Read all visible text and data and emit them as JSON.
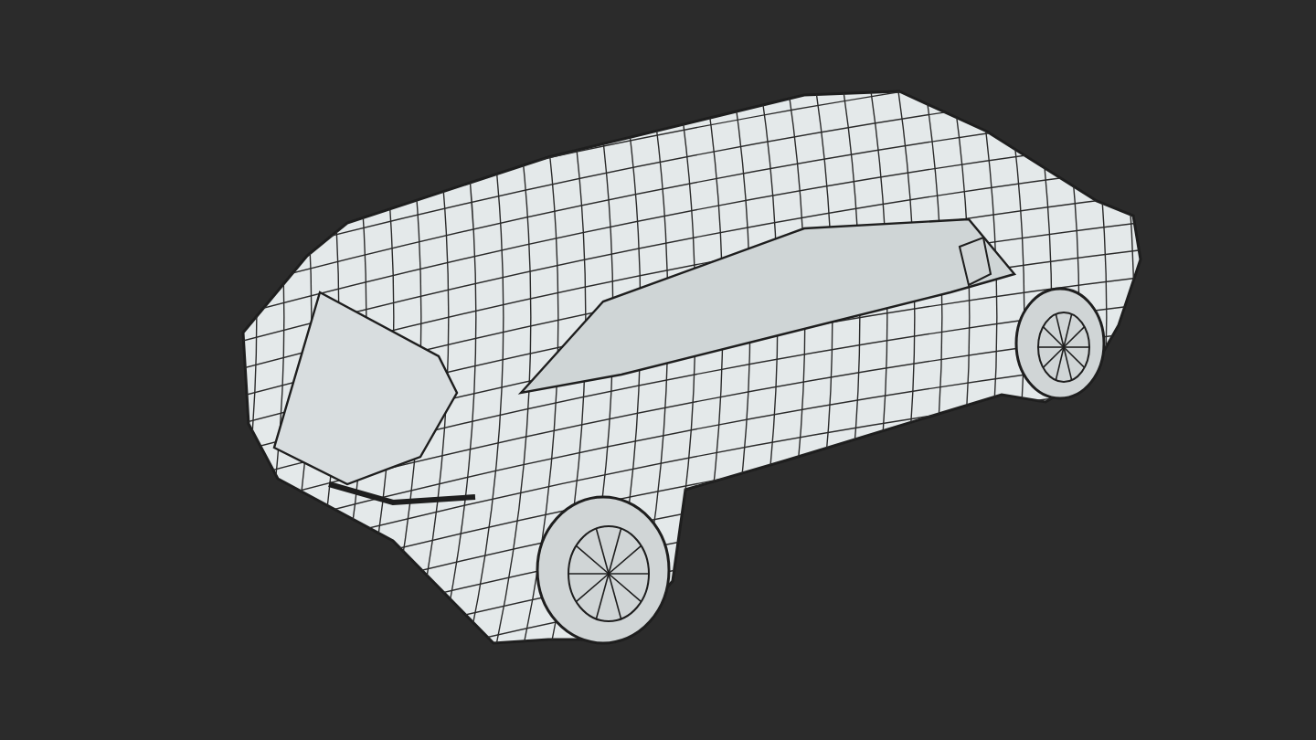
{
  "scene": {
    "kind": "wireframe-car"
  }
}
